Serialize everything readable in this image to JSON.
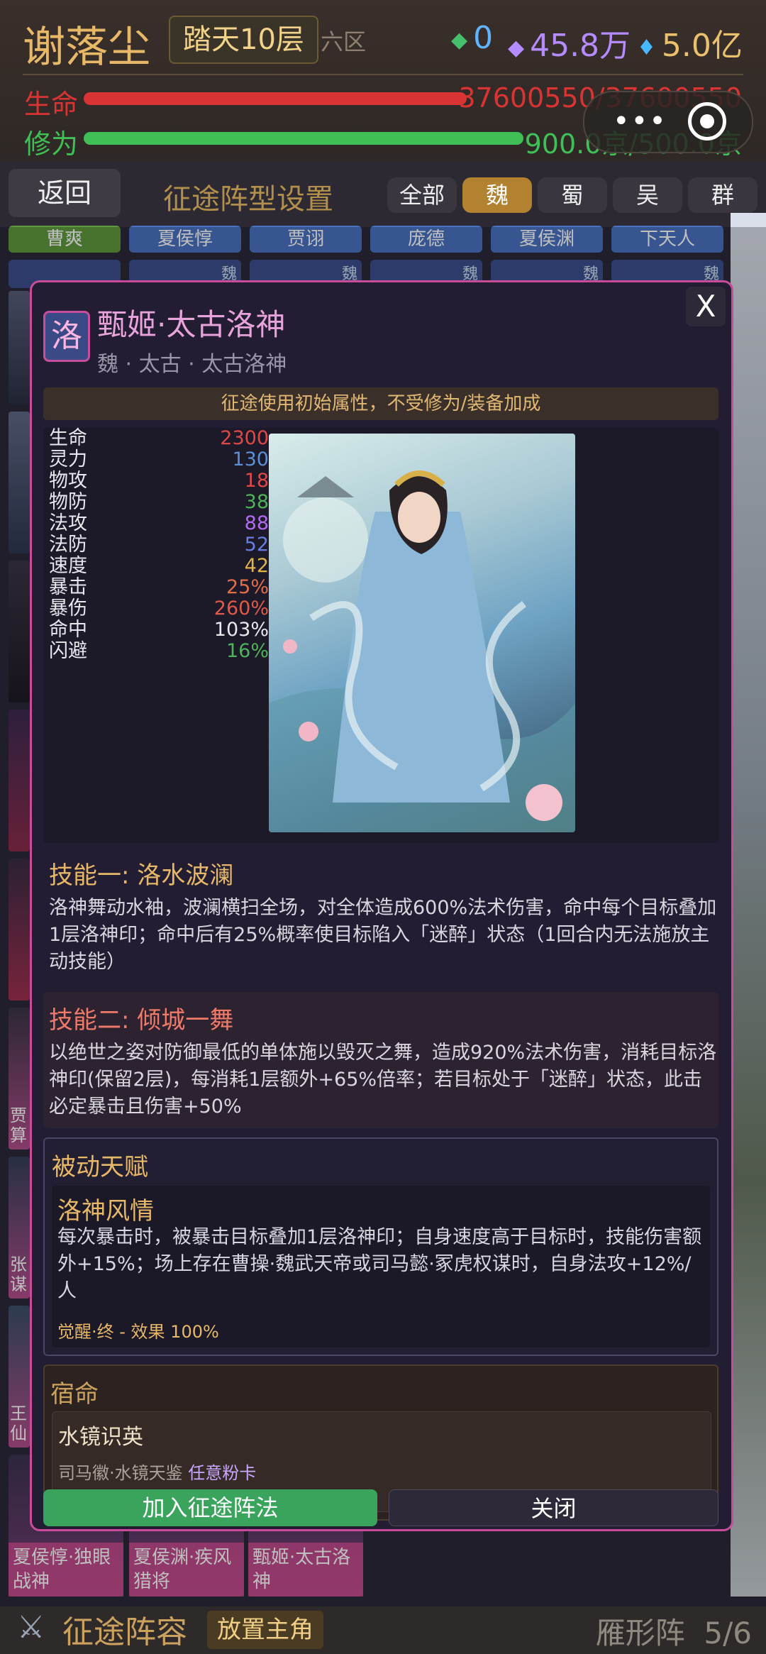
{
  "top": {
    "player_name": "谢落尘",
    "realm": "踏天10层",
    "zone": "六区",
    "currency": [
      {
        "icon": "green-gem-icon",
        "value": "0",
        "color": "#5fb3ff"
      },
      {
        "icon": "purple-diamond-icon",
        "value": "45.8万",
        "color": "#b58cff"
      },
      {
        "icon": "blue-diamond-icon",
        "value": "5.0亿",
        "color": "#e9c06b"
      }
    ],
    "hp": {
      "label": "生命",
      "value": "37600550/37600550",
      "fraction": 1.0,
      "color": "#d93434"
    },
    "cultivation": {
      "label": "修为",
      "value": "900.0京/500.0京",
      "fraction": 1.0,
      "color": "#3fbf56"
    }
  },
  "nav": {
    "back": "返回",
    "title": "征途阵型设置",
    "filters": [
      "全部",
      "魏",
      "蜀",
      "吴",
      "群"
    ],
    "active_filter": "魏"
  },
  "background": {
    "top_names": [
      "曹爽",
      "夏侯惇",
      "贾诩",
      "庞德",
      "夏侯渊",
      "下天人"
    ],
    "faction_tag": "魏",
    "side_names": [
      "贾算",
      "张谋",
      "王仙"
    ],
    "roster": [
      "夏侯惇·独眼战神",
      "夏侯渊·疾风猎将",
      "甄姬·太古洛神"
    ]
  },
  "modal": {
    "close": "X",
    "badge": "洛",
    "title": "甄姬·太古洛神",
    "subtitle": "魏 · 太古 · 太古洛神",
    "notice": "征途使用初始属性，不受修为/装备加成",
    "stats": [
      {
        "k": "生命",
        "v": "2300",
        "c": "#e04848"
      },
      {
        "k": "灵力",
        "v": "130",
        "c": "#5b8fd6"
      },
      {
        "k": "物攻",
        "v": "18",
        "c": "#e04848"
      },
      {
        "k": "物防",
        "v": "38",
        "c": "#4fb35a"
      },
      {
        "k": "法攻",
        "v": "88",
        "c": "#b06bef"
      },
      {
        "k": "法防",
        "v": "52",
        "c": "#6a7de0"
      },
      {
        "k": "速度",
        "v": "42",
        "c": "#e0b34a"
      },
      {
        "k": "暴击",
        "v": "25%",
        "c": "#e06e48"
      },
      {
        "k": "暴伤",
        "v": "260%",
        "c": "#e05a48"
      },
      {
        "k": "命中",
        "v": "103%",
        "c": "#e8e8ee"
      },
      {
        "k": "闪避",
        "v": "16%",
        "c": "#4fb35a"
      }
    ],
    "skill1": {
      "title": "技能一: 洛水波澜",
      "desc": "洛神舞动水袖，波澜横扫全场，对全体造成600%法术伤害，命中每个目标叠加1层洛神印；命中后有25%概率使目标陷入「迷醉」状态（1回合内无法施放主动技能）"
    },
    "skill2": {
      "title": "技能二: 倾城一舞",
      "desc": "以绝世之姿对防御最低的单体施以毁灭之舞，造成920%法术伤害，消耗目标洛神印(保留2层)，每消耗1层额外+65%倍率；若目标处于「迷醉」状态，此击必定暴击且伤害+50%"
    },
    "passive": {
      "header": "被动天赋",
      "name": "洛神风情",
      "desc": "每次暴击时，被暴击目标叠加1层洛神印；自身速度高于目标时，技能伤害额外+15%；场上存在曹操·魏武天帝或司马懿·冢虎权谋时，自身法攻+12%/人",
      "awaken": "觉醒·终 - 效果 100%"
    },
    "fate": {
      "header": "宿命",
      "name": "水镜识英",
      "req_hero": "司马徽·水镜天鉴",
      "req_card": "任意粉卡"
    },
    "btn_join": "加入征途阵法",
    "btn_close": "关闭"
  },
  "bottom": {
    "title": "征途阵容",
    "place": "放置主角",
    "formation": "雁形阵",
    "count": "5/6"
  }
}
